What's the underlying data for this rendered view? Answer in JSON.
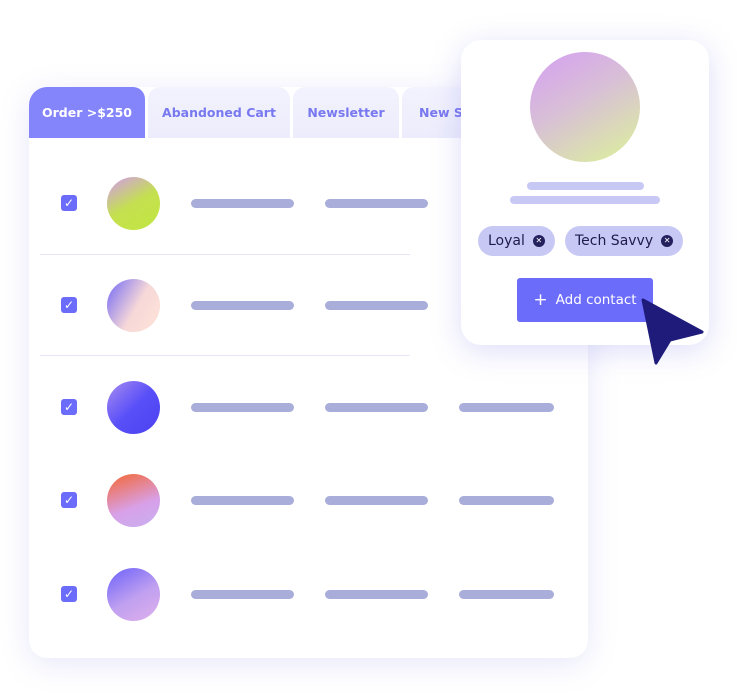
{
  "tabs": [
    {
      "label": "Order >$250",
      "active": true
    },
    {
      "label": "Abandoned Cart"
    },
    {
      "label": "Newsletter"
    },
    {
      "label": "New Su"
    }
  ],
  "rows": [
    {
      "checked": true,
      "avatar": "linear-gradient(150deg,#d2a0e0 5%,#c4e050 50%,#c2e640)"
    },
    {
      "checked": true,
      "avatar": "linear-gradient(120deg,#8a7cf0 10%,#f6d8d8 55%,#ffe4d8)"
    },
    {
      "checked": true,
      "avatar": "linear-gradient(135deg,#a98cf0,#5a50f8 50%,#4a40f0)"
    },
    {
      "checked": true,
      "avatar": "linear-gradient(160deg,#f07050 10%,#d8a0e8 60%,#c8b0f0)"
    },
    {
      "checked": true,
      "avatar": "linear-gradient(150deg,#7a6cf8 10%,#c0a0f0 55%,#e0b0ec)"
    }
  ],
  "popup": {
    "tags": [
      "Loyal",
      "Tech Savvy"
    ],
    "add_label": "Add contact",
    "plus": "+"
  },
  "colors": {
    "accent": "#6c6cfb",
    "tab_active": "#8585fb",
    "cursor": "#1e1b7a"
  }
}
